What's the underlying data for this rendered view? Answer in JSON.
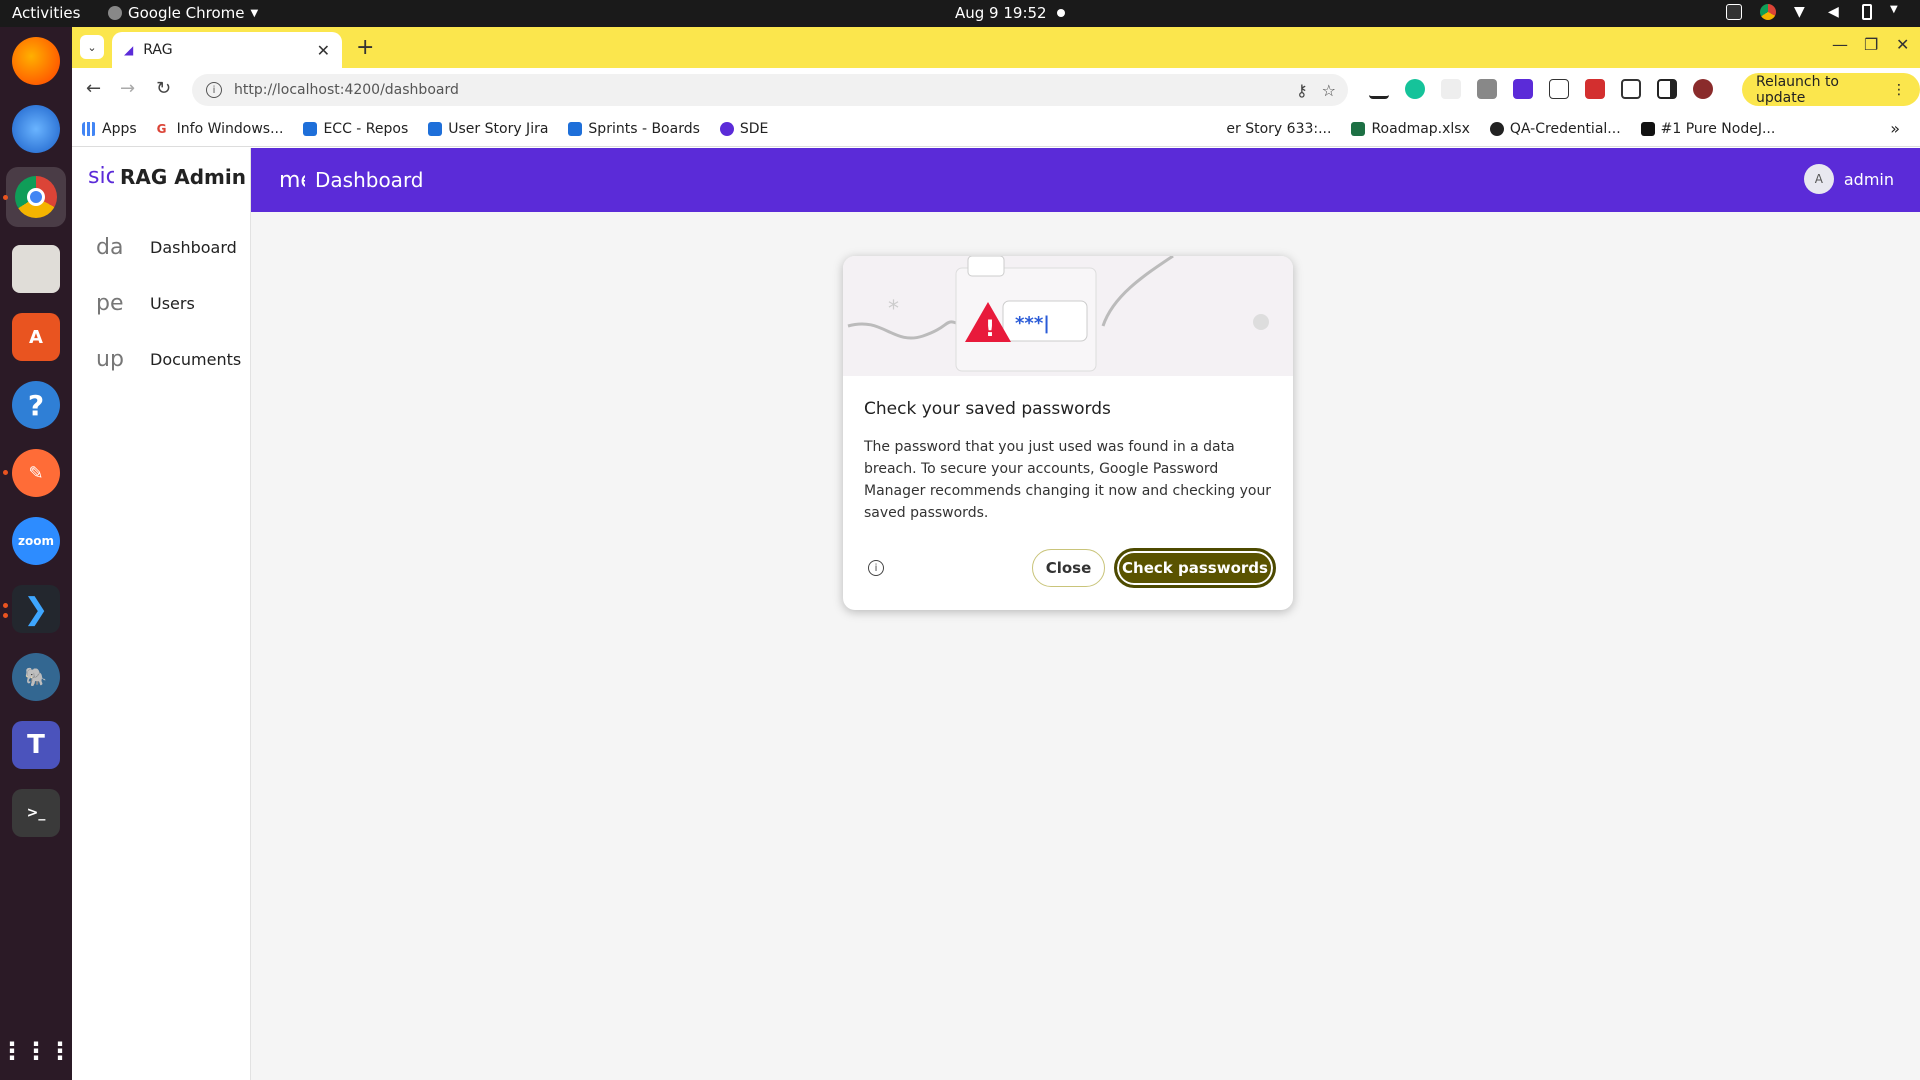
{
  "system": {
    "activities": "Activities",
    "app_name": "Google Chrome",
    "clock": "Aug 9  19:52"
  },
  "browser": {
    "tab_title": "RAG",
    "url": "http://localhost:4200/dashboard",
    "relaunch_label": "Relaunch to update",
    "bookmarks": [
      {
        "label": "Apps"
      },
      {
        "label": "Info Windows..."
      },
      {
        "label": "ECC - Repos"
      },
      {
        "label": "User Story Jira"
      },
      {
        "label": "Sprints - Boards"
      },
      {
        "label": "SDE"
      },
      {
        "label": "er Story 633:..."
      },
      {
        "label": "Roadmap.xlsx"
      },
      {
        "label": "QA-Credential..."
      },
      {
        "label": "#1 Pure NodeJ..."
      }
    ]
  },
  "app": {
    "brand_icon": "sic",
    "brand_name": "RAG Admin",
    "menu_icon": "me",
    "page_title": "Dashboard",
    "user_initial": "A",
    "user_name": "admin",
    "nav": [
      {
        "icon": "da",
        "label": "Dashboard"
      },
      {
        "icon": "pe",
        "label": "Users"
      },
      {
        "icon": "up",
        "label": "Documents"
      }
    ]
  },
  "password_popup": {
    "heading": "Check your saved passwords",
    "body": "The password that you just used was found in a data breach. To secure your accounts, Google Password Manager recommends changing it now and checking your saved passwords.",
    "close_label": "Close",
    "check_label": "Check passwords",
    "illustration_text": "***|"
  }
}
